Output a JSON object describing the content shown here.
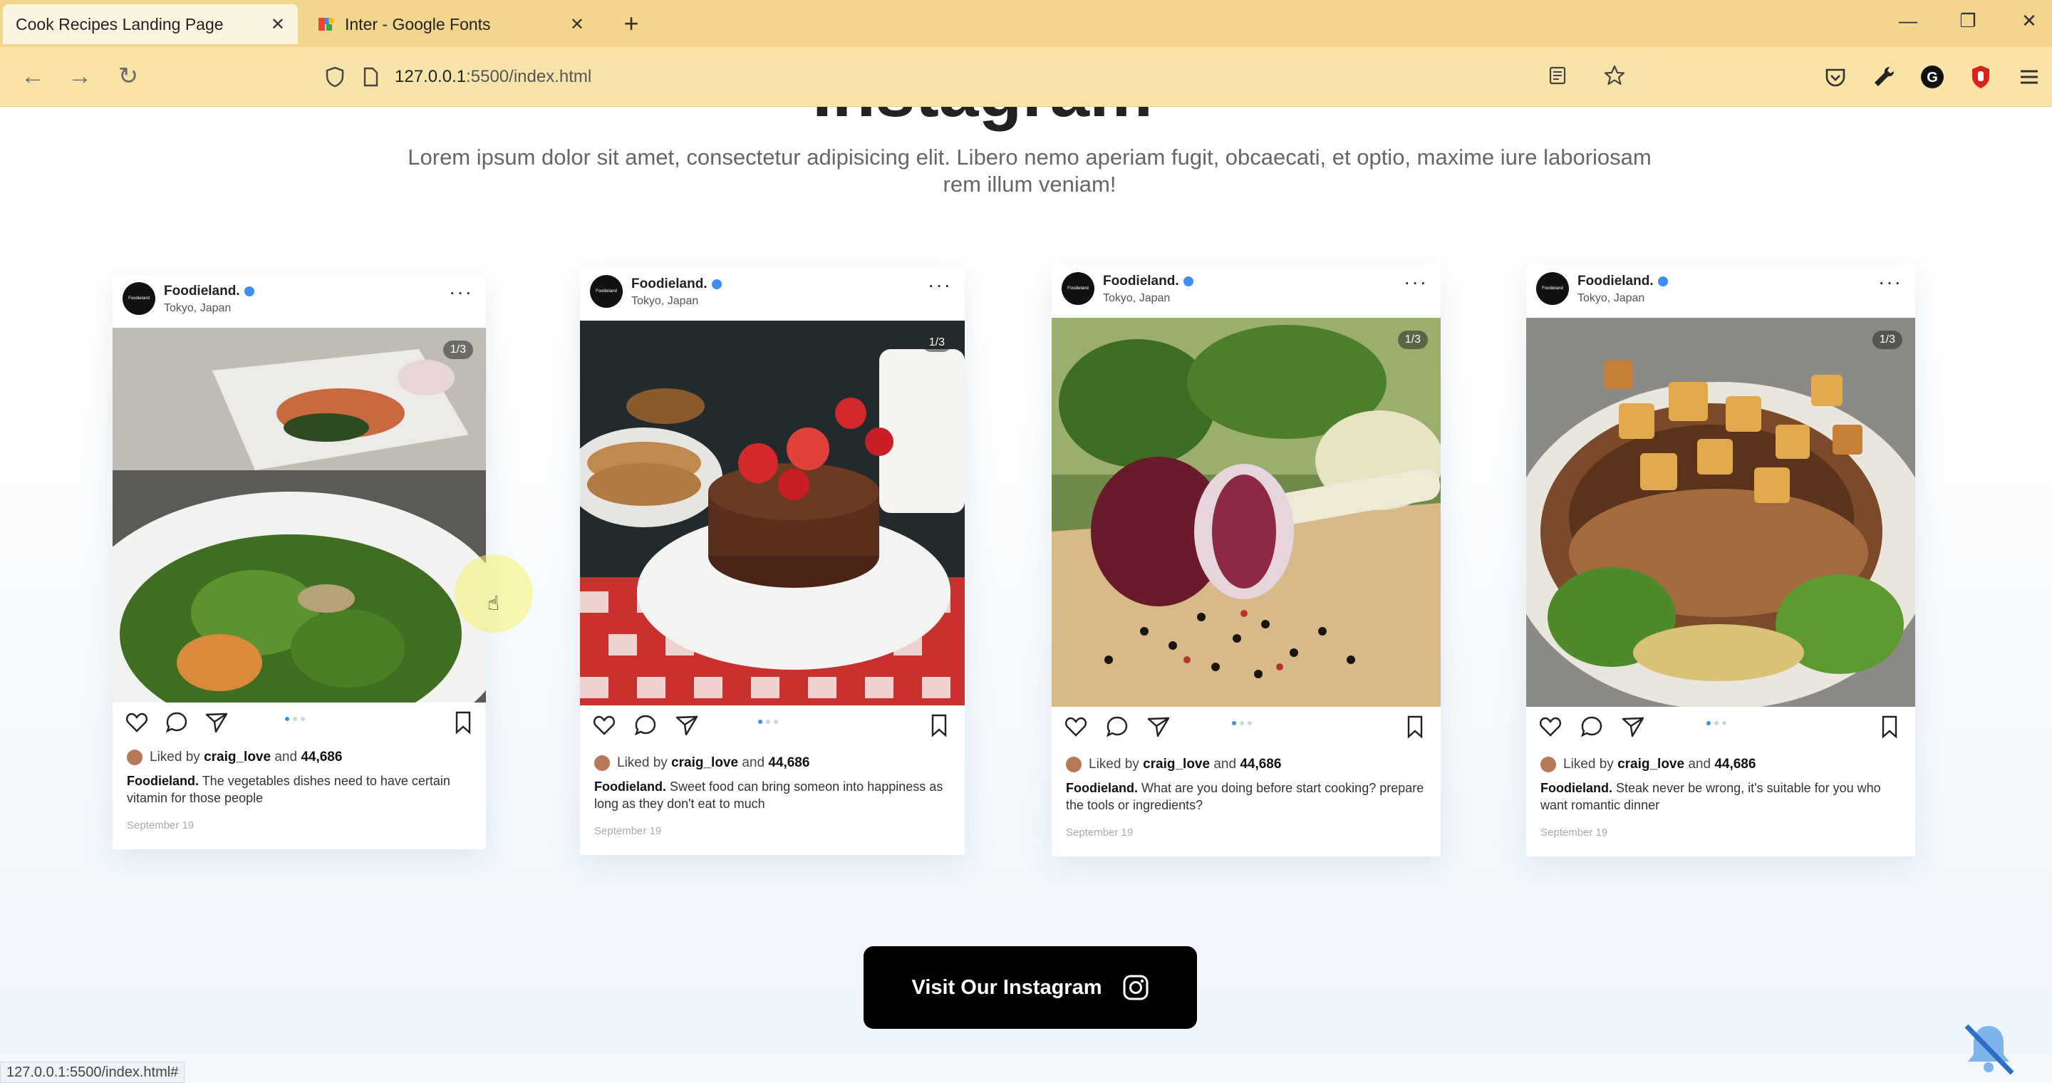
{
  "browser": {
    "tabs": [
      {
        "title": "Cook Recipes Landing Page",
        "active": true
      },
      {
        "title": "Inter - Google Fonts",
        "active": false
      }
    ],
    "url_host": "127.0.0.1",
    "url_path": ":5500/index.html",
    "status_url": "127.0.0.1:5500/index.html#"
  },
  "section": {
    "heading": "Instagram",
    "subtitle": "Lorem ipsum dolor sit amet, consectetur adipisicing elit. Libero nemo aperiam fugit, obcaecati, et optio, maxime iure laboriosam rem illum veniam!"
  },
  "posts": [
    {
      "account": "Foodieland.",
      "avatar_text": "Foodieland",
      "location": "Tokyo, Japan",
      "counter": "1/3",
      "liked_prefix": "Liked by",
      "liked_user": "craig_love",
      "liked_and": "and",
      "liked_count": "44,686",
      "caption_user": "Foodieland.",
      "caption": "The vegetables dishes need to have certain vitamin for those people",
      "date": "September 19",
      "photo": "salad"
    },
    {
      "account": "Foodieland.",
      "avatar_text": "Foodieland",
      "location": "Tokyo, Japan",
      "counter": "1/3",
      "liked_prefix": "Liked by",
      "liked_user": "craig_love",
      "liked_and": "and",
      "liked_count": "44,686",
      "caption_user": "Foodieland.",
      "caption": "Sweet food can bring someon into happiness as long as they don't eat to much",
      "date": "September 19",
      "photo": "pancakes"
    },
    {
      "account": "Foodieland.",
      "avatar_text": "Foodieland",
      "location": "Tokyo, Japan",
      "counter": "1/3",
      "liked_prefix": "Liked by",
      "liked_user": "craig_love",
      "liked_and": "and",
      "liked_count": "44,686",
      "caption_user": "Foodieland.",
      "caption": "What are you doing before start cooking? prepare the  tools or ingredients?",
      "date": "September 19",
      "photo": "onion"
    },
    {
      "account": "Foodieland.",
      "avatar_text": "Foodieland",
      "location": "Tokyo, Japan",
      "counter": "1/3",
      "liked_prefix": "Liked by",
      "liked_user": "craig_love",
      "liked_and": "and",
      "liked_count": "44,686",
      "caption_user": "Foodieland.",
      "caption": "Steak never be wrong, it's suitable for you who want romantic dinner",
      "date": "September 19",
      "photo": "steak"
    }
  ],
  "cta": {
    "label": "Visit Our Instagram",
    "icon": "instagram-icon"
  },
  "colors": {
    "tabbar": "#f4d58d",
    "navbar": "#fbe3a6",
    "accent_blue": "#3d8ef5",
    "cta_bg": "#000000"
  }
}
